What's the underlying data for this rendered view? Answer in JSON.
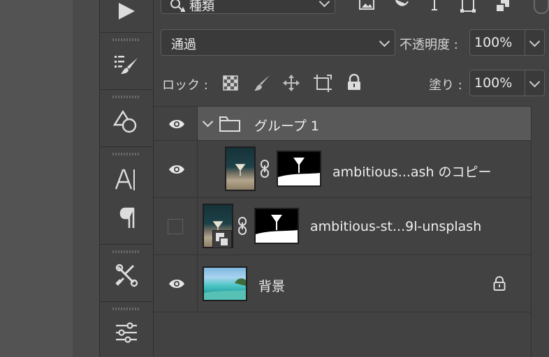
{
  "panel": {
    "filter": {
      "value": "種類"
    },
    "blend_mode": {
      "value": "通過"
    },
    "opacity": {
      "label": "不透明度 :",
      "value": "100%"
    },
    "lock": {
      "label": "ロック :"
    },
    "fill": {
      "label": "塗り :",
      "value": "100%"
    }
  },
  "layers": [
    {
      "name": "グループ 1",
      "type": "group",
      "visible": true,
      "expanded": true,
      "selected": true
    },
    {
      "name": "ambitious...ash のコピー",
      "type": "masked-layer",
      "visible": true
    },
    {
      "name": "ambitious-st...9l-unsplash",
      "type": "smart-object-masked",
      "visible": false
    },
    {
      "name": "背景",
      "type": "background",
      "visible": true,
      "locked": true
    }
  ],
  "tools": [
    "play-icon",
    "brush-preset-icon",
    "shape-icon",
    "character-icon",
    "paragraph-icon",
    "tools-icon",
    "adjustments-icon"
  ],
  "colors": {
    "panel_bg": "#424242",
    "selected_row": "#555555",
    "border": "#5d5d5d"
  }
}
